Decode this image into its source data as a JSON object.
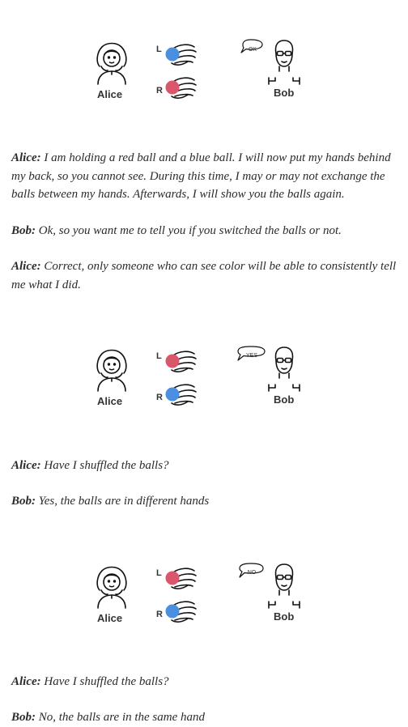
{
  "scenes": [
    {
      "alice": "Alice",
      "bob": "Bob",
      "left_label": "L",
      "right_label": "R",
      "speech": "OK",
      "left_ball_color": "#4a8fe0",
      "right_ball_color": "#d9566b"
    },
    {
      "alice": "Alice",
      "bob": "Bob",
      "left_label": "L",
      "right_label": "R",
      "speech": "YES",
      "left_ball_color": "#d9566b",
      "right_ball_color": "#4a8fe0"
    },
    {
      "alice": "Alice",
      "bob": "Bob",
      "left_label": "L",
      "right_label": "R",
      "speech": "NO",
      "left_ball_color": "#d9566b",
      "right_ball_color": "#4a8fe0"
    }
  ],
  "dialogue": [
    {
      "speaker": "Alice:",
      "text": " I am holding a red ball and a blue ball. I will now put my hands behind my back, so you cannot see. During this time, I may or may not exchange the balls between my hands. Afterwards, I will show you the balls again."
    },
    {
      "speaker": "Bob:",
      "text": " Ok, so you want me to tell you if you switched the balls or not."
    },
    {
      "speaker": "Alice:",
      "text": " Correct, only someone who can see color will be able to consistently tell me what I did."
    },
    {
      "speaker": "Alice:",
      "text": " Have I shuffled the balls?"
    },
    {
      "speaker": "Bob:",
      "text": " Yes, the balls are in different hands"
    },
    {
      "speaker": "Alice:",
      "text": " Have I shuffled the balls?"
    },
    {
      "speaker": "Bob:",
      "text": " No, the balls are in the same hand"
    }
  ]
}
